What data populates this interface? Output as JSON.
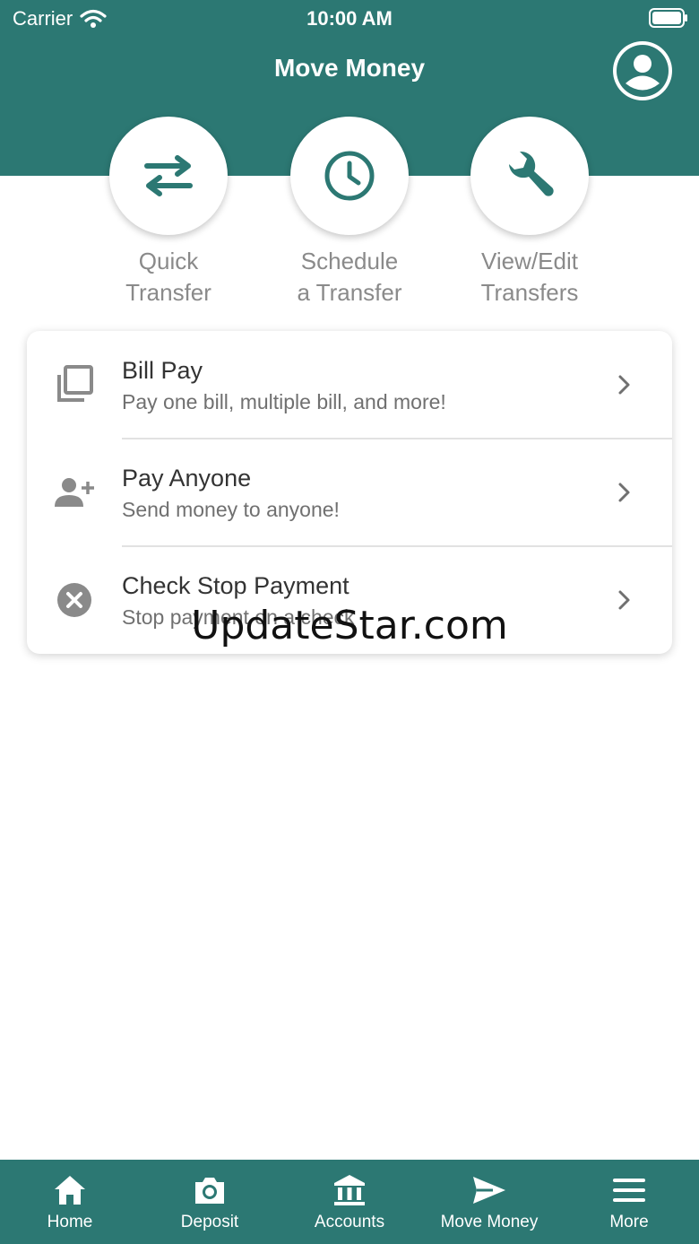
{
  "status_bar": {
    "carrier": "Carrier",
    "time": "10:00 AM"
  },
  "header": {
    "title": "Move Money"
  },
  "quick_actions": [
    {
      "label_line1": "Quick",
      "label_line2": "Transfer",
      "icon": "swap-arrows-icon"
    },
    {
      "label_line1": "Schedule",
      "label_line2": "a Transfer",
      "icon": "clock-icon"
    },
    {
      "label_line1": "View/Edit",
      "label_line2": "Transfers",
      "icon": "wrench-icon"
    }
  ],
  "menu": [
    {
      "title": "Bill Pay",
      "subtitle": "Pay one bill, multiple bill, and more!",
      "icon": "copy-icon"
    },
    {
      "title": "Pay Anyone",
      "subtitle": "Send money to anyone!",
      "icon": "add-person-icon"
    },
    {
      "title": "Check Stop Payment",
      "subtitle": "Stop payment on a check",
      "icon": "cancel-circle-icon"
    }
  ],
  "watermark": "UpdateStar.com",
  "tabs": [
    {
      "label": "Home",
      "icon": "home-icon"
    },
    {
      "label": "Deposit",
      "icon": "camera-icon"
    },
    {
      "label": "Accounts",
      "icon": "bank-icon"
    },
    {
      "label": "Move Money",
      "icon": "send-icon",
      "active": true
    },
    {
      "label": "More",
      "icon": "menu-icon"
    }
  ],
  "colors": {
    "brand": "#2c7873",
    "surface": "#ffffff",
    "muted_text": "#8a8a8a"
  }
}
